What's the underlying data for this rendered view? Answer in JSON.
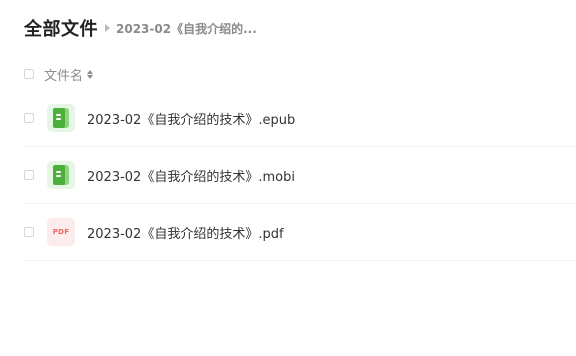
{
  "header": {
    "title": "全部文件",
    "breadcrumb_current": "2023-02《自我介绍的..."
  },
  "list_header": {
    "column_label": "文件名"
  },
  "files": [
    {
      "name": "2023-02《自我介绍的技术》.epub",
      "icon": "book-icon"
    },
    {
      "name": "2023-02《自我介绍的技术》.mobi",
      "icon": "book-icon"
    },
    {
      "name": "2023-02《自我介绍的技术》.pdf",
      "icon": "pdf-icon",
      "icon_text": "PDF"
    }
  ],
  "colors": {
    "book_green": "#4caf3c",
    "pdf_red": "#f06464"
  }
}
